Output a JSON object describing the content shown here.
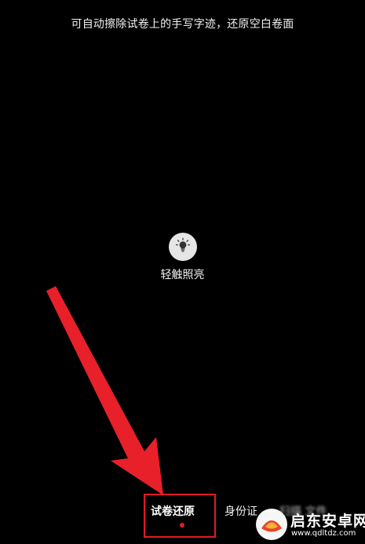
{
  "scanner": {
    "hint_text": "可自动擦除试卷上的手写字迹，还原空白卷面",
    "torch_label": "轻触照亮"
  },
  "modes": {
    "active_label": "试卷还原",
    "second_label": "身份证",
    "blurred_label": "扫描  文件"
  },
  "watermark": {
    "title": "启东安卓网",
    "url": "www.qdltdz.com"
  },
  "colors": {
    "background": "#000000",
    "highlight": "#e01b22",
    "arrow": "#e8202a",
    "active_dot": "#d8202a"
  }
}
